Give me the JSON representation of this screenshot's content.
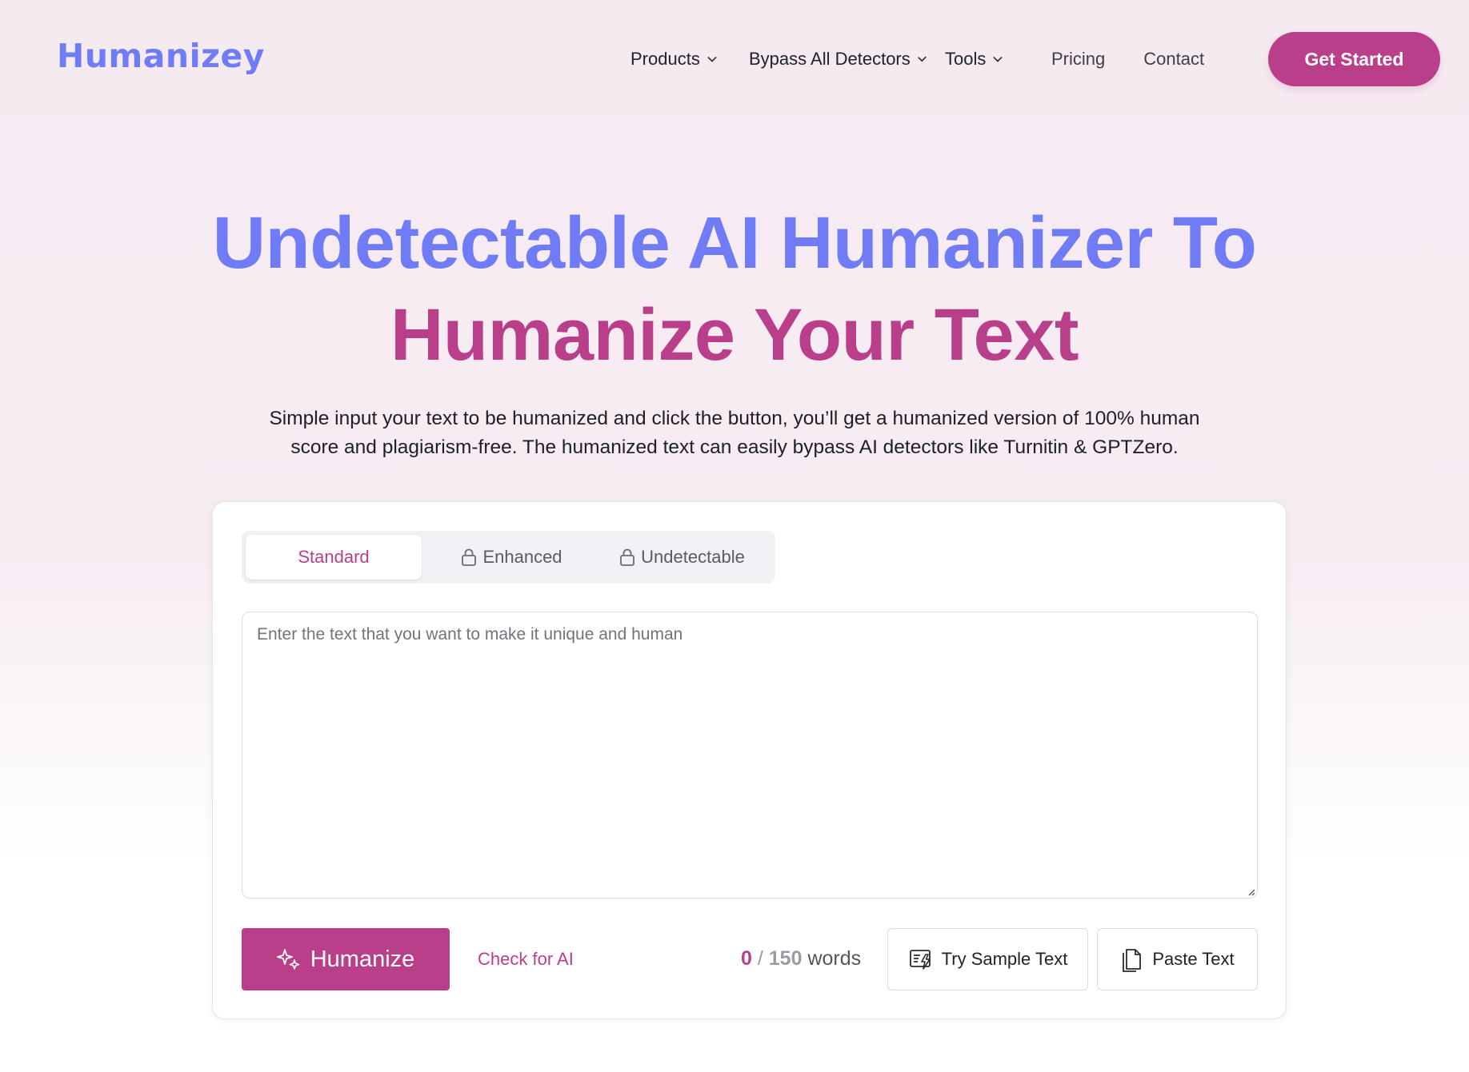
{
  "header": {
    "logo": "Humanizey",
    "nav": [
      {
        "label": "Products",
        "has_dropdown": true
      },
      {
        "label": "Bypass All Detectors",
        "has_dropdown": true
      },
      {
        "label": "Tools",
        "has_dropdown": true
      },
      {
        "label": "Pricing",
        "has_dropdown": false
      },
      {
        "label": "Contact",
        "has_dropdown": false
      }
    ],
    "cta_label": "Get Started"
  },
  "hero": {
    "title_line1": "Undetectable AI Humanizer To",
    "title_line2": "Humanize Your Text",
    "subtitle": "Simple input your text to be humanized and click the button, you’ll get a humanized version of 100% human score and plagiarism-free. The humanized text can easily bypass AI detectors like Turnitin & GPTZero."
  },
  "tool": {
    "modes": [
      {
        "label": "Standard",
        "active": true,
        "locked": false,
        "icon": ""
      },
      {
        "label": "Enhanced",
        "active": false,
        "locked": true,
        "icon": "lock-icon"
      },
      {
        "label": "Undetectable",
        "active": false,
        "locked": true,
        "icon": "lock-icon"
      }
    ],
    "input": {
      "value": "",
      "placeholder": "Enter the text that you want to make it unique and human"
    },
    "humanize_label": "Humanize",
    "humanize_icon": "sparkles-icon",
    "check_ai_label": "Check for AI",
    "word_count": {
      "current": "0",
      "separator": "/",
      "limit": "150",
      "unit": "words"
    },
    "sample_label": "Try Sample Text",
    "sample_icon": "sample-text-icon",
    "paste_label": "Paste Text",
    "paste_icon": "paste-icon"
  },
  "colors": {
    "brand_blue": "#6f7cf5",
    "brand_magenta": "#b93f8a",
    "background_tint": "#f6eaf1"
  }
}
